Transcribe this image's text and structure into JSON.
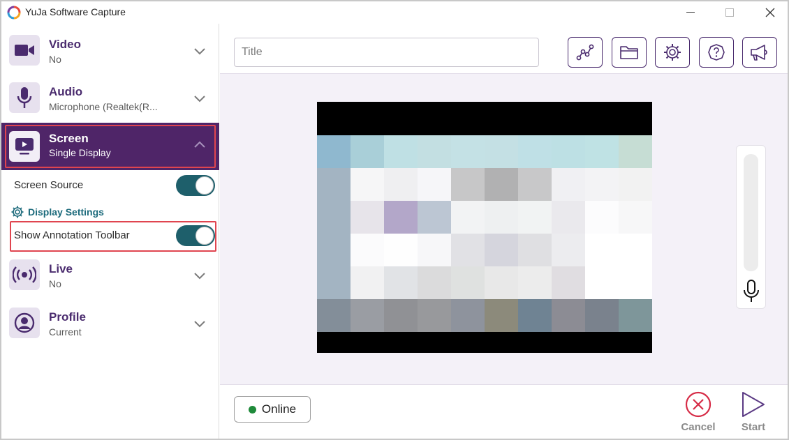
{
  "window": {
    "title": "YuJa Software Capture"
  },
  "sidebar": {
    "sections": [
      {
        "title": "Video",
        "subtitle": "No",
        "icon": "video-camera-icon"
      },
      {
        "title": "Audio",
        "subtitle": "Microphone (Realtek(R...",
        "icon": "microphone-icon"
      },
      {
        "title": "Screen",
        "subtitle": "Single Display",
        "icon": "screen-icon",
        "expanded": true
      },
      {
        "title": "Live",
        "subtitle": "No",
        "icon": "broadcast-icon"
      },
      {
        "title": "Profile",
        "subtitle": "Current",
        "icon": "profile-icon"
      }
    ],
    "screen_options": {
      "screen_source_label": "Screen Source",
      "screen_source_on": true,
      "display_settings_label": "Display Settings",
      "annotation_toolbar_label": "Show Annotation Toolbar",
      "annotation_toolbar_on": true
    }
  },
  "header": {
    "title_placeholder": "Title",
    "tools": [
      "analytics-icon",
      "folder-icon",
      "settings-icon",
      "help-icon",
      "announcement-icon"
    ]
  },
  "footer": {
    "status_text": "Online",
    "cancel_label": "Cancel",
    "start_label": "Start"
  },
  "colors": {
    "accent_purple": "#4f2568",
    "toggle_teal": "#1e5f6b",
    "highlight_red": "#e0454f",
    "status_green": "#1f8a3a",
    "cancel_red": "#d62b46"
  }
}
